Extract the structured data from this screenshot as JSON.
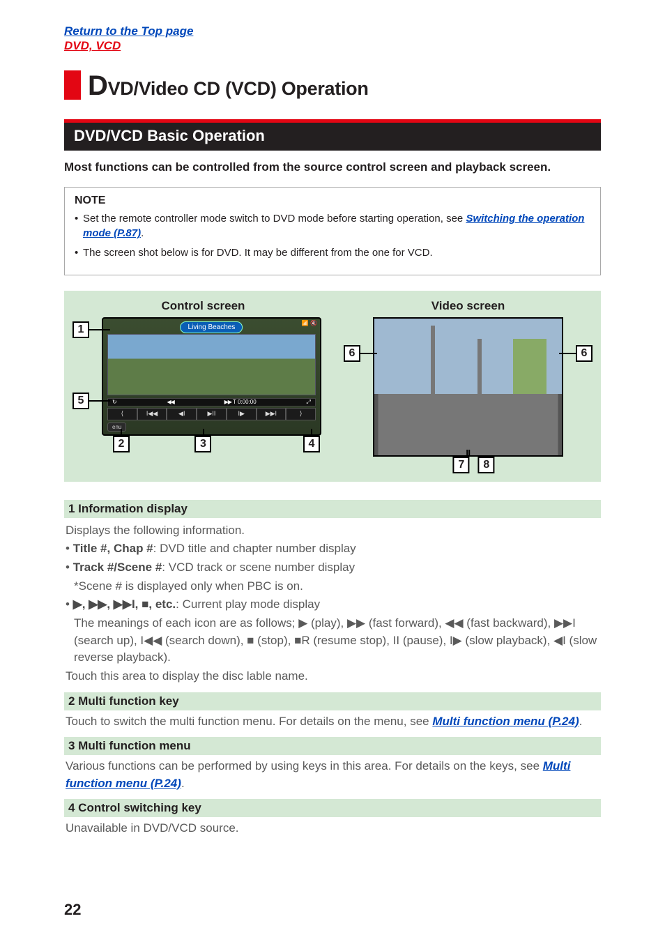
{
  "top_links": {
    "return": "Return to the Top page",
    "section": "DVD, VCD"
  },
  "title": {
    "bigD": "D",
    "rest": "VD/Video CD (VCD) Operation"
  },
  "section_bar": "DVD/VCD Basic Operation",
  "intro": "Most functions can be controlled from the source control screen and playback screen.",
  "note": {
    "heading": "NOTE",
    "items": [
      {
        "pre": "Set the remote controller mode switch to DVD mode before starting operation, see ",
        "link": "Switching the operation mode (P.87)",
        "post": "."
      },
      {
        "pre": "The screen shot below is for DVD. It may be different from the one for VCD.",
        "link": "",
        "post": ""
      }
    ]
  },
  "figure": {
    "control_caption": "Control screen",
    "video_caption": "Video screen",
    "control": {
      "titlebar": "Living Beaches",
      "meter_time": "T 0:00:00",
      "meter_ff": "▶▶",
      "meter_rew": "◀◀",
      "meter_loop": "↻",
      "meter_expand": "⤢",
      "funcbtns": [
        "⟨",
        "I◀◀",
        "◀I",
        "▶II",
        "I▶",
        "▶▶I",
        "⟩"
      ],
      "menu_chip": "enu"
    },
    "badges": {
      "b1": "1",
      "b2": "2",
      "b3": "3",
      "b4": "4",
      "b5": "5",
      "b6": "6",
      "b7": "7",
      "b8": "8"
    }
  },
  "descriptions": {
    "d1": {
      "head": "1  Information display",
      "body_intro": "Displays the following information.",
      "row_title": {
        "label": "Title #, Chap #",
        "text": ": DVD title and chapter number display"
      },
      "row_track": {
        "label": "Track #/Scene #",
        "text": ": VCD track or scene number display"
      },
      "row_track_note": "*Scene # is displayed only when PBC is on.",
      "row_icons_label": "▶, ▶▶, ▶▶I, ■, etc.",
      "row_icons_text": ": Current play mode display",
      "row_icons_expl": "The meanings of each icon are as follows; ▶ (play), ▶▶ (fast forward), ◀◀ (fast backward), ▶▶I (search up), I◀◀ (search down), ■ (stop), ■R (resume stop), II (pause), I▶ (slow playback), ◀I (slow reverse playback).",
      "row_touch": "Touch this area to display the disc lable name."
    },
    "d2": {
      "head": "2  Multi function key",
      "body_pre": "Touch to switch the multi function menu. For details on the menu, see ",
      "link": "Multi function menu (P.24)",
      "body_post": "."
    },
    "d3": {
      "head": "3  Multi function menu",
      "body_pre": "Various functions can be performed by using keys in this area. For details on the keys, see ",
      "link": "Multi function menu (P.24)",
      "body_post": "."
    },
    "d4": {
      "head": "4  Control switching key",
      "body": "Unavailable in DVD/VCD source."
    }
  },
  "page_number": "22"
}
